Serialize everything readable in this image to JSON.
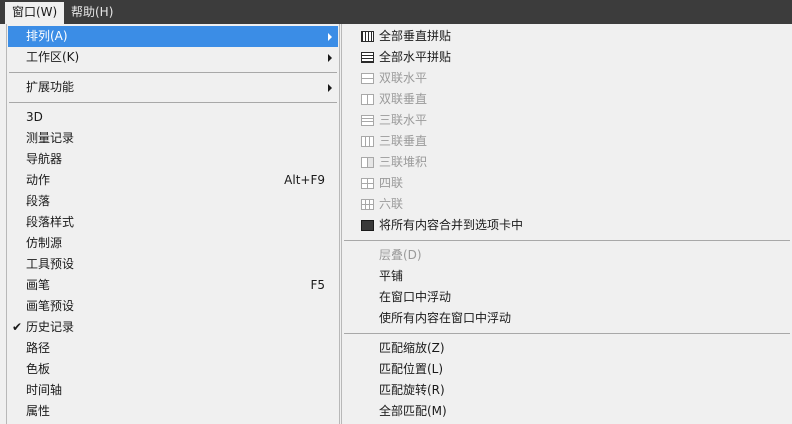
{
  "menubar": {
    "items": [
      {
        "label": "窗口(W)",
        "active": true
      },
      {
        "label": "帮助(H)",
        "active": false
      }
    ]
  },
  "window_menu": {
    "arrange": "排列(A)",
    "workspace": "工作区(K)",
    "extensions": "扩展功能",
    "panels": [
      {
        "label": "3D",
        "shortcut": ""
      },
      {
        "label": "测量记录",
        "shortcut": ""
      },
      {
        "label": "导航器",
        "shortcut": ""
      },
      {
        "label": "动作",
        "shortcut": "Alt+F9"
      },
      {
        "label": "段落",
        "shortcut": ""
      },
      {
        "label": "段落样式",
        "shortcut": ""
      },
      {
        "label": "仿制源",
        "shortcut": ""
      },
      {
        "label": "工具预设",
        "shortcut": ""
      },
      {
        "label": "画笔",
        "shortcut": "F5"
      },
      {
        "label": "画笔预设",
        "shortcut": ""
      },
      {
        "label": "历史记录",
        "shortcut": "",
        "checked": true,
        "check_glyph": "✔"
      },
      {
        "label": "路径",
        "shortcut": ""
      },
      {
        "label": "色板",
        "shortcut": ""
      },
      {
        "label": "时间轴",
        "shortcut": ""
      },
      {
        "label": "属性",
        "shortcut": ""
      }
    ]
  },
  "arrange_submenu": {
    "layouts": [
      {
        "label": "全部垂直拼贴",
        "icon": "tile-vertical-icon",
        "enabled": true
      },
      {
        "label": "全部水平拼贴",
        "icon": "tile-horizontal-icon",
        "enabled": true
      },
      {
        "label": "双联水平",
        "icon": "two-up-horizontal-icon",
        "enabled": false
      },
      {
        "label": "双联垂直",
        "icon": "two-up-vertical-icon",
        "enabled": false
      },
      {
        "label": "三联水平",
        "icon": "three-up-horizontal-icon",
        "enabled": false
      },
      {
        "label": "三联垂直",
        "icon": "three-up-vertical-icon",
        "enabled": false
      },
      {
        "label": "三联堆积",
        "icon": "three-up-stacked-icon",
        "enabled": false
      },
      {
        "label": "四联",
        "icon": "four-up-icon",
        "enabled": false
      },
      {
        "label": "六联",
        "icon": "six-up-icon",
        "enabled": false
      },
      {
        "label": "将所有内容合并到选项卡中",
        "icon": "consolidate-tabs-icon",
        "enabled": true
      }
    ],
    "window_actions": [
      {
        "label": "层叠(D)",
        "enabled": false
      },
      {
        "label": "平铺",
        "enabled": true
      },
      {
        "label": "在窗口中浮动",
        "enabled": true
      },
      {
        "label": "使所有内容在窗口中浮动",
        "enabled": true
      }
    ],
    "match_actions": [
      {
        "label": "匹配缩放(Z)",
        "enabled": true
      },
      {
        "label": "匹配位置(L)",
        "enabled": true
      },
      {
        "label": "匹配旋转(R)",
        "enabled": true
      },
      {
        "label": "全部匹配(M)",
        "enabled": true
      }
    ]
  },
  "colors": {
    "menubar_bg": "#3c3c3c",
    "menu_bg": "#f0f0f0",
    "highlight": "#3b8de6",
    "disabled_text": "#9a9a9a"
  }
}
